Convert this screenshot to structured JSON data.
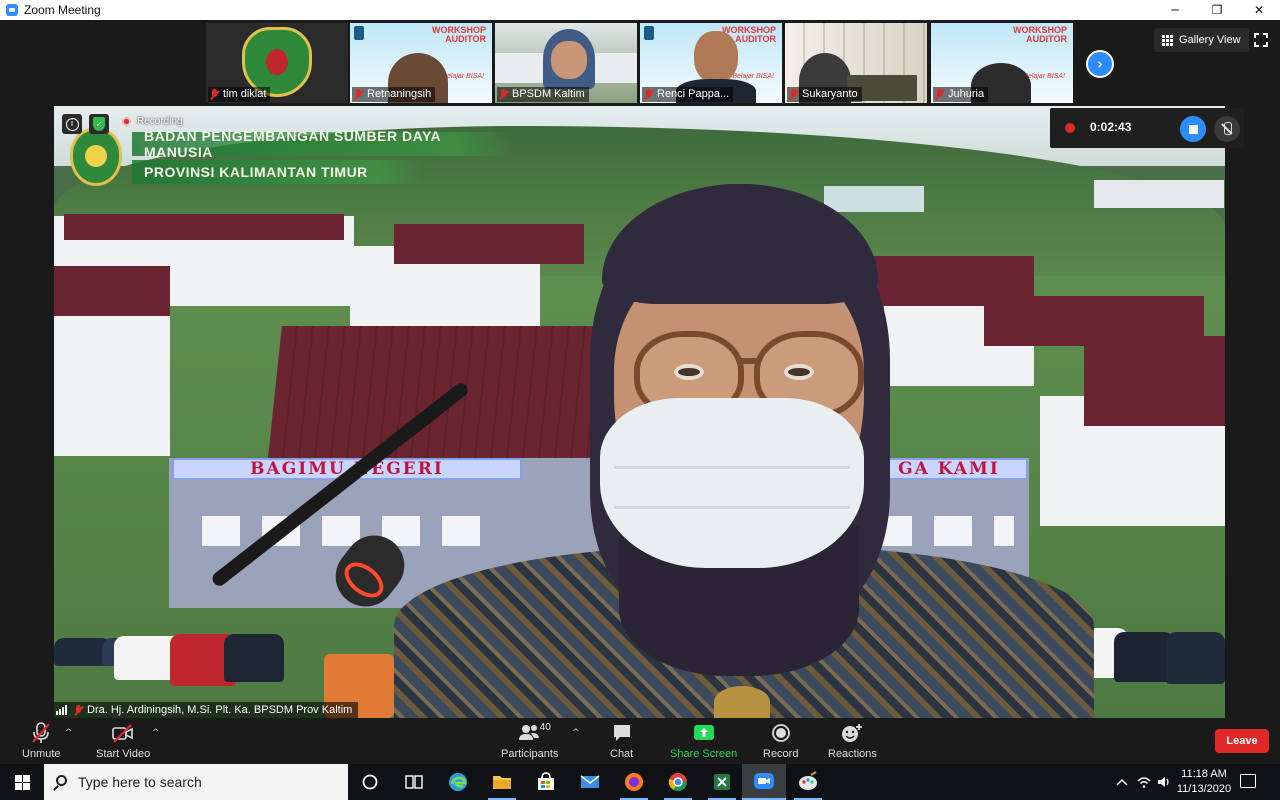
{
  "window": {
    "title": "Zoom Meeting",
    "minimize_glyph": "─",
    "maximize_glyph": "❐",
    "close_glyph": "✕"
  },
  "gallery": {
    "participants": [
      {
        "name": "tim diklat",
        "muted": true
      },
      {
        "name": "Retnaningsih",
        "muted": true
      },
      {
        "name": "BPSDM Kaltim",
        "muted": true
      },
      {
        "name": "Renci Pappa...",
        "muted": true
      },
      {
        "name": "Sukaryanto",
        "muted": true
      },
      {
        "name": "Juhuria",
        "muted": true
      }
    ],
    "workshop_title": "WORKSHOP\nAUDITOR",
    "workshop_tagline": "Belajar BISA!",
    "next_glyph": "›",
    "view_label": "Gallery View"
  },
  "main_video": {
    "org_line1": "BADAN PENGEMBANGAN SUMBER DAYA MANUSIA",
    "org_line2": "PROVINSI KALIMANTAN TIMUR",
    "banner_left": "BAGIMU NEGERI",
    "banner_right": "GA KAMI",
    "recording_label": "Recording",
    "speaker_name": "Dra. Hj. Ardiningsih, M.Si. Plt. Ka. BPSDM Prov Kaltim",
    "info_glyph": "i",
    "shield_glyph": "✓"
  },
  "recording_panel": {
    "elapsed": "0:02:43"
  },
  "toolbar": {
    "unmute": "Unmute",
    "start_video": "Start Video",
    "participants": "Participants",
    "participant_count": "40",
    "chat": "Chat",
    "share_screen": "Share Screen",
    "record": "Record",
    "reactions": "Reactions",
    "leave": "Leave",
    "caret_glyph": "^"
  },
  "taskbar": {
    "search_placeholder": "Type here to search",
    "time": "11:18 AM",
    "date": "11/13/2020",
    "apps": [
      "task-view",
      "edge",
      "file-explorer",
      "store",
      "mail",
      "firefox",
      "chrome",
      "excel",
      "zoom",
      "paint"
    ]
  },
  "colors": {
    "zoom_blue": "#2d8cff",
    "leave_red": "#e02828",
    "share_green": "#23d959",
    "toolbar_bg": "#1a1a1a"
  }
}
